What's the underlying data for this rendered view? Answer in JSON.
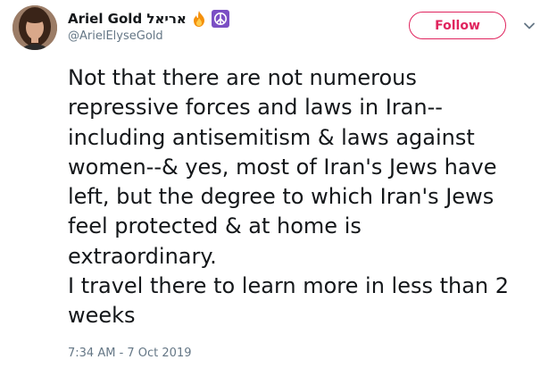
{
  "author": {
    "display_name": "Ariel Gold אריאל",
    "handle": "@ArielElyseGold",
    "emojis": [
      "fire-emoji",
      "peace-symbol-emoji"
    ]
  },
  "follow_button": {
    "label": "Follow"
  },
  "tweet": {
    "lines": [
      "Not that there are not numerous",
      "repressive forces and laws in Iran--",
      "including antisemitism & laws against",
      "women--& yes, most of Iran's Jews have",
      "left, but the degree to which Iran's Jews",
      "feel protected & at home is",
      "extraordinary.",
      "I travel there to learn more in less than 2",
      "weeks"
    ],
    "timestamp": "7:34 AM - 7 Oct 2019"
  },
  "colors": {
    "text": "#14171a",
    "secondary_text": "#657786",
    "follow_accent": "#e0245e",
    "peace_emoji_bg": "#7b4fc4"
  },
  "icons": {
    "menu": "chevron-down-icon",
    "avatar": "user-avatar"
  }
}
